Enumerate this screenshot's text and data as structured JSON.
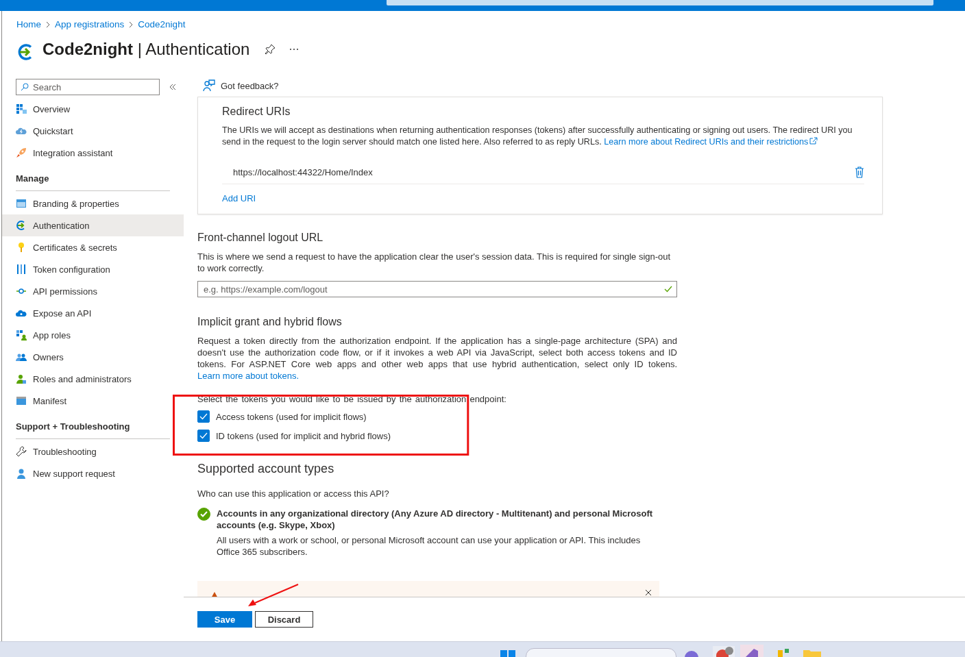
{
  "breadcrumb": [
    {
      "label": "Home"
    },
    {
      "label": "App registrations"
    },
    {
      "label": "Code2night"
    }
  ],
  "page": {
    "app_name": "Code2night",
    "separator": "|",
    "section": "Authentication"
  },
  "sidebar": {
    "search_placeholder": "Search",
    "sections": [
      {
        "items": [
          {
            "label": "Overview",
            "selected": false
          },
          {
            "label": "Quickstart",
            "selected": false
          },
          {
            "label": "Integration assistant",
            "selected": false
          }
        ]
      },
      {
        "heading": "Manage",
        "items": [
          {
            "label": "Branding & properties",
            "selected": false
          },
          {
            "label": "Authentication",
            "selected": true
          },
          {
            "label": "Certificates & secrets",
            "selected": false
          },
          {
            "label": "Token configuration",
            "selected": false
          },
          {
            "label": "API permissions",
            "selected": false
          },
          {
            "label": "Expose an API",
            "selected": false
          },
          {
            "label": "App roles",
            "selected": false
          },
          {
            "label": "Owners",
            "selected": false
          },
          {
            "label": "Roles and administrators",
            "selected": false
          },
          {
            "label": "Manifest",
            "selected": false
          }
        ]
      },
      {
        "heading": "Support + Troubleshooting",
        "items": [
          {
            "label": "Troubleshooting",
            "selected": false
          },
          {
            "label": "New support request",
            "selected": false
          }
        ]
      }
    ]
  },
  "feedback": "Got feedback?",
  "redirect_uris": {
    "title": "Redirect URIs",
    "description": "The URIs we will accept as destinations when returning authentication responses (tokens) after successfully authenticating or signing out users. The redirect URI you send in the request to the login server should match one listed here. Also referred to as reply URLs.",
    "link": "Learn more about Redirect URIs and their restrictions",
    "uris": [
      "https://localhost:44322/Home/Index"
    ],
    "add_link": "Add URI"
  },
  "logout": {
    "title": "Front-channel logout URL",
    "description": "This is where we send a request to have the application clear the user's session data. This is required for single sign-out to work correctly.",
    "placeholder": "e.g. https://example.com/logout"
  },
  "implicit": {
    "title": "Implicit grant and hybrid flows",
    "description": "Request a token directly from the authorization endpoint. If the application has a single-page architecture (SPA) and doesn't use the authorization code flow, or if it invokes a web API via JavaScript, select both access tokens and ID tokens. For ASP.NET Core web apps and other web apps that use hybrid authentication, select only ID tokens.",
    "link": "Learn more about tokens.",
    "prompt": "Select the tokens you would like to be issued by the authorization endpoint:",
    "options": [
      {
        "label": "Access tokens (used for implicit flows)",
        "checked": true
      },
      {
        "label": "ID tokens (used for implicit and hybrid flows)",
        "checked": true
      }
    ]
  },
  "account_types": {
    "title": "Supported account types",
    "question": "Who can use this application or access this API?",
    "options": [
      {
        "label": "Accounts in any organizational directory (Any Azure AD directory - Multitenant) and personal Microsoft accounts (e.g. Skype, Xbox)",
        "description": "All users with a work or school, or personal Microsoft account can use your application or API. This includes Office 365 subscribers.",
        "selected": true
      }
    ]
  },
  "buttons": [
    {
      "label": "Save",
      "kind": "primary"
    },
    {
      "label": "Discard",
      "kind": "secondary"
    }
  ]
}
